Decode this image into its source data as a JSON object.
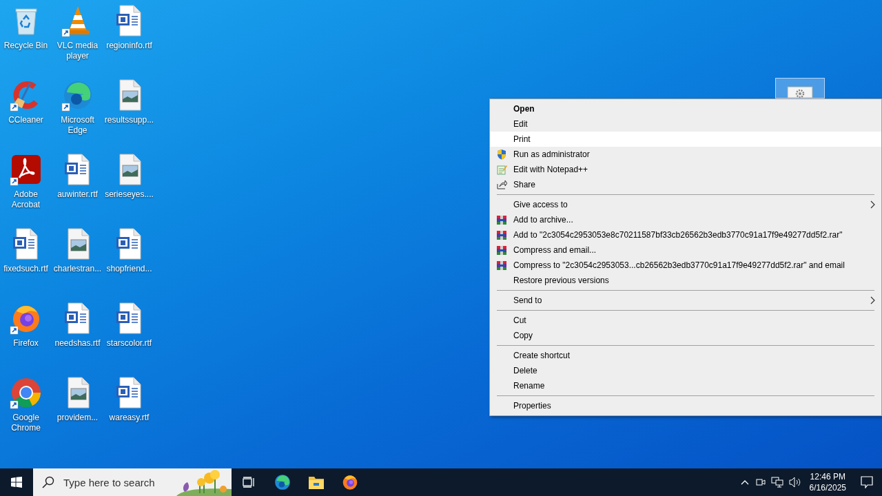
{
  "desktop": {
    "icons": [
      {
        "label": "Recycle Bin",
        "kind": "recycle",
        "shortcut": false
      },
      {
        "label": "CCleaner",
        "kind": "ccleaner",
        "shortcut": true
      },
      {
        "label": "Adobe Acrobat",
        "kind": "acrobat",
        "shortcut": true
      },
      {
        "label": "fixedsuch.rtf",
        "kind": "rtf",
        "shortcut": false
      },
      {
        "label": "Firefox",
        "kind": "firefox",
        "shortcut": true
      },
      {
        "label": "Google Chrome",
        "kind": "chrome",
        "shortcut": true
      },
      {
        "label": "VLC media player",
        "kind": "vlc",
        "shortcut": true
      },
      {
        "label": "Microsoft Edge",
        "kind": "edge",
        "shortcut": true
      },
      {
        "label": "auwinter.rtf",
        "kind": "rtf",
        "shortcut": false
      },
      {
        "label": "charlestran...",
        "kind": "image",
        "shortcut": false
      },
      {
        "label": "needshas.rtf",
        "kind": "rtf",
        "shortcut": false
      },
      {
        "label": "providem...",
        "kind": "image",
        "shortcut": false
      },
      {
        "label": "regioninfo.rtf",
        "kind": "rtf",
        "shortcut": false
      },
      {
        "label": "resultssupp...",
        "kind": "image",
        "shortcut": false
      },
      {
        "label": "serieseyes....",
        "kind": "image",
        "shortcut": false
      },
      {
        "label": "shopfriend...",
        "kind": "rtf",
        "shortcut": false
      },
      {
        "label": "starscolor.rtf",
        "kind": "rtf",
        "shortcut": false
      },
      {
        "label": "wareasy.rtf",
        "kind": "rtf",
        "shortcut": false
      }
    ],
    "partial_icon": {
      "selected": true
    }
  },
  "menu": {
    "items": [
      {
        "kind": "item",
        "label": "Open",
        "selected": false,
        "default": true,
        "submenu": false
      },
      {
        "kind": "item",
        "label": "Edit",
        "selected": false,
        "default": false,
        "submenu": false
      },
      {
        "kind": "item",
        "label": "Print",
        "selected": true,
        "default": false,
        "submenu": false
      },
      {
        "kind": "item",
        "label": "Run as administrator",
        "selected": false,
        "default": false,
        "submenu": false
      },
      {
        "kind": "item",
        "label": "Edit with Notepad++",
        "selected": false,
        "default": false,
        "submenu": false
      },
      {
        "kind": "item",
        "label": "Share",
        "selected": false,
        "default": false,
        "submenu": false
      },
      {
        "kind": "separator"
      },
      {
        "kind": "item",
        "label": "Give access to",
        "selected": false,
        "default": false,
        "submenu": true
      },
      {
        "kind": "item",
        "label": "Add to archive...",
        "selected": false,
        "default": false,
        "submenu": false
      },
      {
        "kind": "item",
        "label": "Add to \"2c3054c2953053e8c70211587bf33cb26562b3edb3770c91a17f9e49277dd5f2.rar\"",
        "selected": false,
        "default": false,
        "submenu": false
      },
      {
        "kind": "item",
        "label": "Compress and email...",
        "selected": false,
        "default": false,
        "submenu": false
      },
      {
        "kind": "item",
        "label": "Compress to \"2c3054c2953053...cb26562b3edb3770c91a17f9e49277dd5f2.rar\" and email",
        "selected": false,
        "default": false,
        "submenu": false
      },
      {
        "kind": "item",
        "label": "Restore previous versions",
        "selected": false,
        "default": false,
        "submenu": false
      },
      {
        "kind": "separator"
      },
      {
        "kind": "item",
        "label": "Send to",
        "selected": false,
        "default": false,
        "submenu": true
      },
      {
        "kind": "separator"
      },
      {
        "kind": "item",
        "label": "Cut",
        "selected": false,
        "default": false,
        "submenu": false
      },
      {
        "kind": "item",
        "label": "Copy",
        "selected": false,
        "default": false,
        "submenu": false
      },
      {
        "kind": "separator"
      },
      {
        "kind": "item",
        "label": "Create shortcut",
        "selected": false,
        "default": false,
        "submenu": false
      },
      {
        "kind": "item",
        "label": "Delete",
        "selected": false,
        "default": false,
        "submenu": false
      },
      {
        "kind": "item",
        "label": "Rename",
        "selected": false,
        "default": false,
        "submenu": false
      },
      {
        "kind": "separator"
      },
      {
        "kind": "item",
        "label": "Properties",
        "selected": false,
        "default": false,
        "submenu": false
      }
    ]
  },
  "taskbar": {
    "search": {
      "placeholder": "Type here to search"
    },
    "clock": {
      "time": "12:46 PM",
      "date": "6/16/2025"
    }
  }
}
